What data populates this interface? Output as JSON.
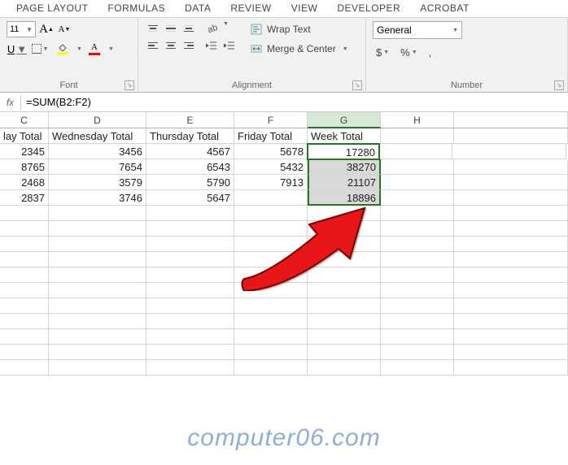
{
  "ribbon": {
    "tabs": [
      "PAGE LAYOUT",
      "FORMULAS",
      "DATA",
      "REVIEW",
      "VIEW",
      "DEVELOPER",
      "ACROBAT"
    ],
    "font": {
      "size": "11",
      "label": "Font",
      "underline_letter": "U",
      "bigA": "A",
      "smallA": "A",
      "fontcolor_letter": "A"
    },
    "alignment": {
      "wrap": "Wrap Text",
      "merge": "Merge & Center",
      "label": "Alignment"
    },
    "number": {
      "format": "General",
      "label": "Number",
      "currency": "$",
      "percent": "%",
      "comma": ","
    }
  },
  "formula_bar": {
    "fx": "fx",
    "value": "=SUM(B2:F2)"
  },
  "columns": [
    "C",
    "D",
    "E",
    "F",
    "G",
    "H"
  ],
  "headers": {
    "C": "lay Total",
    "D": "Wednesday Total",
    "E": "Thursday Total",
    "F": "Friday Total",
    "G": "Week Total"
  },
  "rows": [
    {
      "C": "2345",
      "D": "3456",
      "E": "4567",
      "F": "5678",
      "G": "17280"
    },
    {
      "C": "8765",
      "D": "7654",
      "E": "6543",
      "F": "5432",
      "G": "38270"
    },
    {
      "C": "2468",
      "D": "3579",
      "E": "5790",
      "F": "7913",
      "G": "21107"
    },
    {
      "C": "2837",
      "D": "3746",
      "E": "5647",
      "F": "",
      "G": "18896"
    }
  ],
  "chart_data": {
    "type": "table",
    "columns": [
      "Wednesday Total",
      "Thursday Total",
      "Friday Total",
      "Week Total"
    ],
    "rows": [
      [
        3456,
        4567,
        5678,
        17280
      ],
      [
        7654,
        6543,
        5432,
        38270
      ],
      [
        3579,
        5790,
        7913,
        21107
      ],
      [
        3746,
        5647,
        null,
        18896
      ]
    ]
  },
  "watermark": "computer06.com"
}
